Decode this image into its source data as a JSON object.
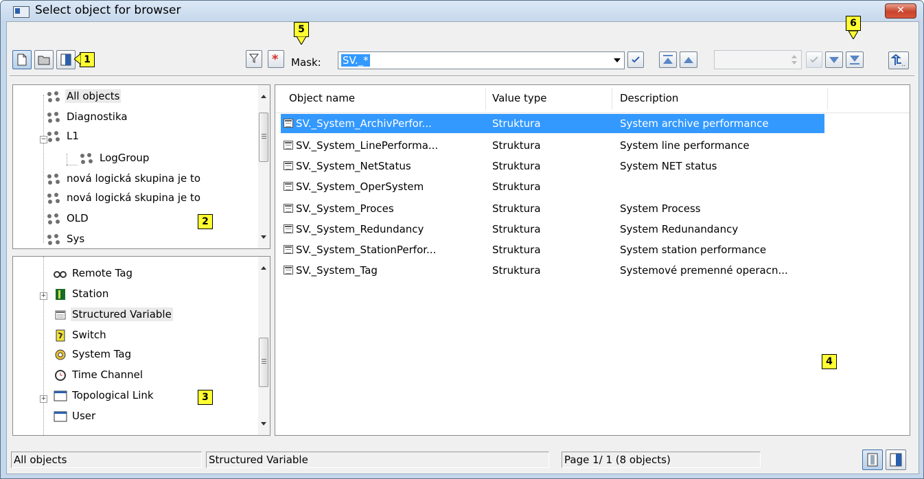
{
  "window": {
    "title": "Select object for browser",
    "close_label": "✕"
  },
  "toolbar": {
    "mask_label": "Mask:",
    "mask_value": "SV._*"
  },
  "callouts": {
    "c1": "1",
    "c2": "2",
    "c3": "3",
    "c4": "4",
    "c5": "5",
    "c6": "6"
  },
  "logical_groups": {
    "items": [
      {
        "label": "All objects"
      },
      {
        "label": "Diagnostika"
      },
      {
        "label": "L1"
      },
      {
        "label": "LogGroup"
      },
      {
        "label": "nová logická skupina je to"
      },
      {
        "label": "nová logická skupina je to"
      },
      {
        "label": "OLD"
      },
      {
        "label": "Sys"
      }
    ]
  },
  "object_types": {
    "items": [
      {
        "label": "Remote Tag"
      },
      {
        "label": "Station"
      },
      {
        "label": "Structured Variable"
      },
      {
        "label": "Switch"
      },
      {
        "label": "System Tag"
      },
      {
        "label": "Time Channel"
      },
      {
        "label": "Topological Link"
      },
      {
        "label": "User"
      }
    ]
  },
  "objects_table": {
    "columns": [
      "Object name",
      "Value type",
      "Description"
    ],
    "rows": [
      {
        "name": "SV._System_ArchivPerfor...",
        "type": "Struktura",
        "description": "System archive performance"
      },
      {
        "name": "SV._System_LinePerforma...",
        "type": "Struktura",
        "description": "System line performance"
      },
      {
        "name": "SV._System_NetStatus",
        "type": "Struktura",
        "description": "System NET status"
      },
      {
        "name": "SV._System_OperSystem",
        "type": "Struktura",
        "description": ""
      },
      {
        "name": "SV._System_Proces",
        "type": "Struktura",
        "description": "System Process"
      },
      {
        "name": "SV._System_Redundancy",
        "type": "Struktura",
        "description": "System Redunandancy"
      },
      {
        "name": "SV._System_StationPerfor...",
        "type": "Struktura",
        "description": "System station performance"
      },
      {
        "name": "SV._System_Tag",
        "type": "Struktura",
        "description": "Systemové premenné operacn..."
      }
    ]
  },
  "statusbar": {
    "group": "All objects",
    "type": "Structured Variable",
    "page": "Page  1/ 1   (8 objects)"
  }
}
